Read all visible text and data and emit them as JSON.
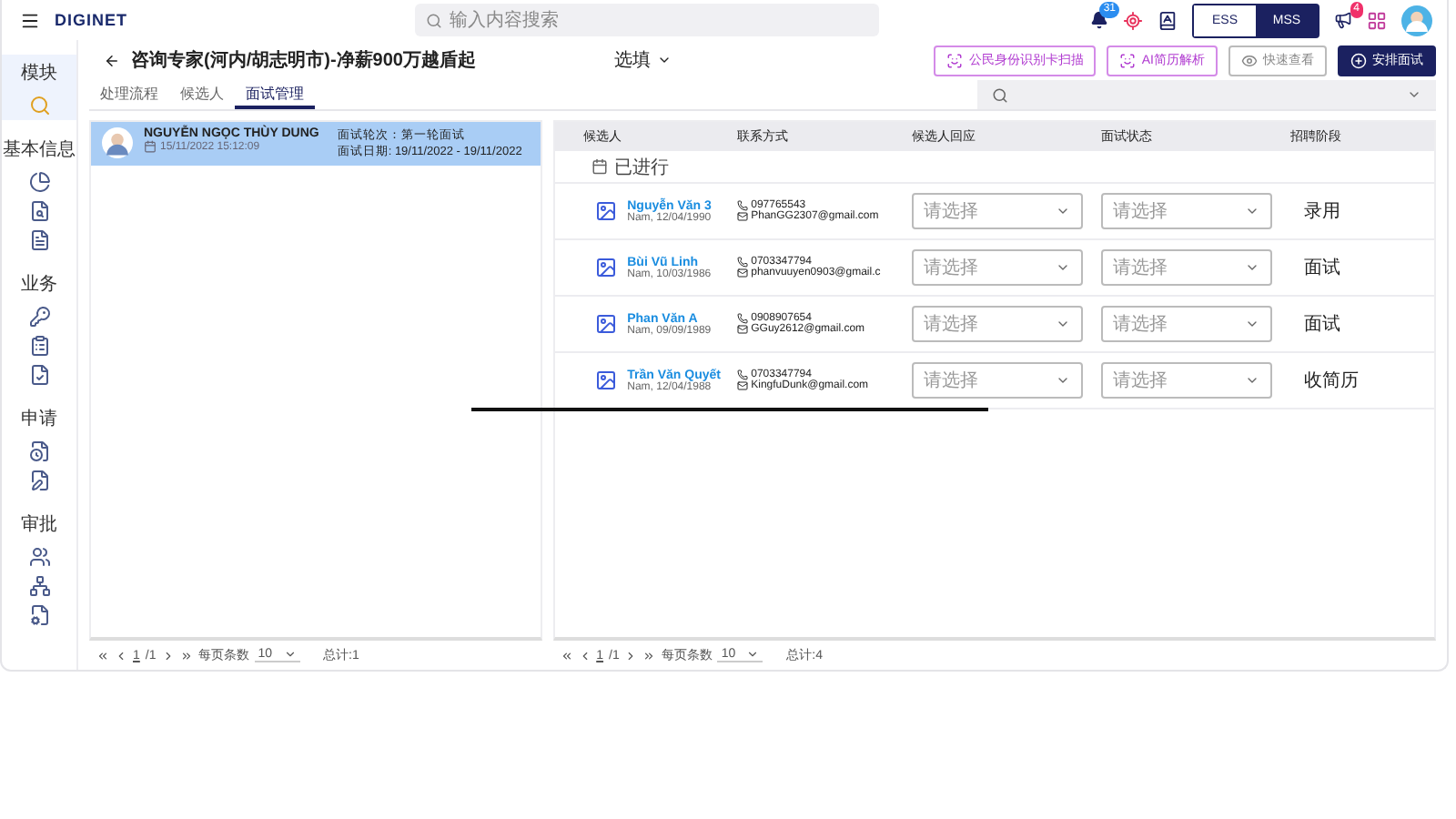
{
  "topbar": {
    "logo": "DIGINET",
    "search": {
      "placeholder": "输入内容搜索"
    },
    "notification_count": "31",
    "modes": [
      {
        "label": "ESS",
        "selected": false
      },
      {
        "label": "MSS",
        "selected": true
      }
    ],
    "announcement_count": "4"
  },
  "sidebar": {
    "groups": [
      {
        "label": "模块",
        "selected": true,
        "items": [
          {
            "kind": "search"
          }
        ]
      },
      {
        "label": "基本信息",
        "selected": false,
        "items": [
          {
            "kind": "pie"
          },
          {
            "kind": "file-search"
          },
          {
            "kind": "file-text"
          }
        ]
      },
      {
        "label": "业务",
        "selected": false,
        "items": [
          {
            "kind": "key"
          },
          {
            "kind": "clipboard"
          },
          {
            "kind": "file-check"
          }
        ]
      },
      {
        "label": "申请",
        "selected": false,
        "items": [
          {
            "kind": "file-clock"
          },
          {
            "kind": "file-pen"
          }
        ]
      },
      {
        "label": "审批",
        "selected": false,
        "items": [
          {
            "kind": "users"
          },
          {
            "kind": "network"
          },
          {
            "kind": "file-cog"
          }
        ]
      }
    ]
  },
  "header": {
    "title": "咨询专家(河内/胡志明市)-净薪900万越盾起",
    "select": "选填",
    "actions": [
      {
        "label": "公民身份识别卡扫描",
        "kind": "scan"
      },
      {
        "label": "AI简历解析",
        "kind": "scan"
      },
      {
        "label": "快速查看",
        "kind": "view"
      },
      {
        "label": "安排面试",
        "kind": "primary"
      }
    ]
  },
  "tabs": [
    {
      "label": "处理流程",
      "selected": false
    },
    {
      "label": "候选人",
      "selected": false
    },
    {
      "label": "面试管理",
      "selected": true
    }
  ],
  "interview_list": {
    "items": [
      {
        "name": "NGUYỄN NGỌC THÙY DUNG",
        "datetime": "15/11/2022 15:12:09",
        "round": "面试轮次：第一轮面试",
        "date": "面试日期: 19/11/2022 - 19/11/2022",
        "selected": true
      }
    ],
    "pagination": {
      "page": "1",
      "pages": "/1",
      "page_size_label": "每页条数",
      "page_size": "10",
      "total": "总计:1"
    }
  },
  "candidates": {
    "columns": [
      "候选人",
      "联系方式",
      "候选人回应",
      "面试状态",
      "招聘阶段"
    ],
    "group": "已进行",
    "rows": [
      {
        "name": "Nguyễn Văn 3",
        "info": "Nam, 12/04/1990",
        "phone": "097765543",
        "email": "PhanGG2307@gmail.com",
        "response": "请选择",
        "status": "请选择",
        "stage": "录用"
      },
      {
        "name": "Bùi Vũ Linh",
        "info": "Nam, 10/03/1986",
        "phone": "0703347794",
        "email": "phanvuuyen0903@gmail.c",
        "response": "请选择",
        "status": "请选择",
        "stage": "面试"
      },
      {
        "name": "Phan Văn A",
        "info": "Nam, 09/09/1989",
        "phone": "0908907654",
        "email": "GGuy2612@gmail.com",
        "response": "请选择",
        "status": "请选择",
        "stage": "面试"
      },
      {
        "name": "Trần Văn Quyết",
        "info": "Nam, 12/04/1988",
        "phone": "0703347794",
        "email": "KingfuDunk@gmail.com",
        "response": "请选择",
        "status": "请选择",
        "stage": "收简历"
      }
    ],
    "pagination": {
      "page": "1",
      "pages": "/1",
      "page_size_label": "每页条数",
      "page_size": "10",
      "total": "总计:4"
    }
  }
}
